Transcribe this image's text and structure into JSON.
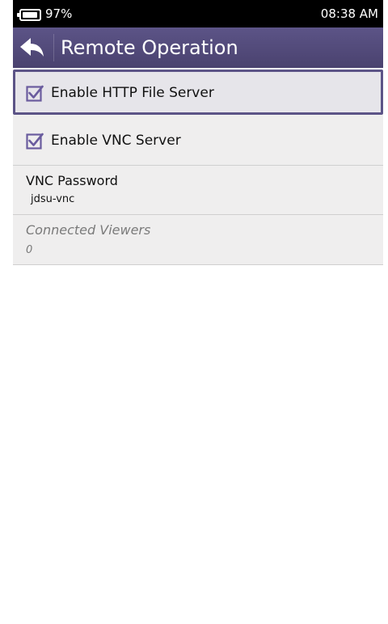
{
  "status_bar": {
    "battery_percent": "97%",
    "battery_level": 0.97,
    "time": "08:38 AM"
  },
  "header": {
    "title": "Remote Operation",
    "back_icon": "back-arrow-icon"
  },
  "settings": {
    "http_server": {
      "label": "Enable HTTP File Server",
      "checked": true
    },
    "vnc_server": {
      "label": "Enable VNC Server",
      "checked": true
    },
    "vnc_password": {
      "label": "VNC Password",
      "value": "jdsu-vnc"
    },
    "connected_viewers": {
      "label": "Connected Viewers",
      "value": "0"
    }
  },
  "colors": {
    "accent": "#5c5487",
    "header": "#4f4775",
    "row_background": "#efeeee",
    "disabled_text": "#7a7a7a"
  }
}
